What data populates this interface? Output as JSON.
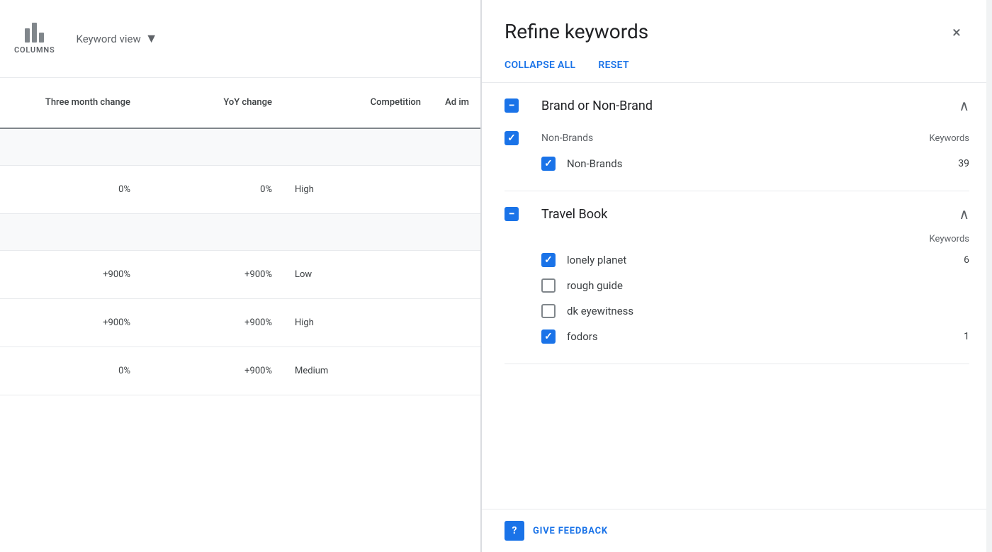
{
  "toolbar": {
    "columns_label": "COLUMNS",
    "keyword_view_label": "Keyword view"
  },
  "table": {
    "headers": [
      {
        "id": "three-month-change",
        "label": "Three month change"
      },
      {
        "id": "yoy-change",
        "label": "YoY change"
      },
      {
        "id": "competition",
        "label": "Competition"
      },
      {
        "id": "ad-im",
        "label": "Ad im"
      }
    ],
    "rows": [
      {
        "type": "group-header",
        "cells": [
          "",
          "",
          "",
          ""
        ]
      },
      {
        "type": "data",
        "cells": [
          "0%",
          "0%",
          "High",
          ""
        ]
      },
      {
        "type": "group-header",
        "cells": [
          "",
          "",
          "",
          ""
        ]
      },
      {
        "type": "data",
        "cells": [
          "+900%",
          "+900%",
          "Low",
          ""
        ]
      },
      {
        "type": "data",
        "cells": [
          "+900%",
          "+900%",
          "High",
          ""
        ]
      },
      {
        "type": "data",
        "cells": [
          "0%",
          "+900%",
          "Medium",
          ""
        ]
      }
    ]
  },
  "refine": {
    "title": "Refine keywords",
    "collapse_all": "COLLAPSE ALL",
    "reset": "RESET",
    "close_label": "×",
    "sections": [
      {
        "id": "brand-or-non-brand",
        "title": "Brand or Non-Brand",
        "state": "indeterminate",
        "expanded": true,
        "groups": [
          {
            "id": "non-brands-group",
            "label": "Non-Brands",
            "col_header": "Keywords",
            "state": "checked",
            "items": [
              {
                "id": "non-brands",
                "label": "Non-Brands",
                "count": "39",
                "checked": true
              }
            ]
          }
        ]
      },
      {
        "id": "travel-book",
        "title": "Travel Book",
        "state": "indeterminate",
        "expanded": true,
        "groups": [
          {
            "id": "travel-book-group",
            "label": "",
            "col_header": "Keywords",
            "state": "none",
            "items": [
              {
                "id": "lonely-planet",
                "label": "lonely planet",
                "count": "6",
                "checked": true
              },
              {
                "id": "rough-guide",
                "label": "rough guide",
                "count": "",
                "checked": false
              },
              {
                "id": "dk-eyewitness",
                "label": "dk eyewitness",
                "count": "",
                "checked": false
              },
              {
                "id": "fodors",
                "label": "fodors",
                "count": "1",
                "checked": true
              }
            ]
          }
        ]
      }
    ],
    "feedback": {
      "icon": "?",
      "label": "GIVE FEEDBACK"
    }
  }
}
